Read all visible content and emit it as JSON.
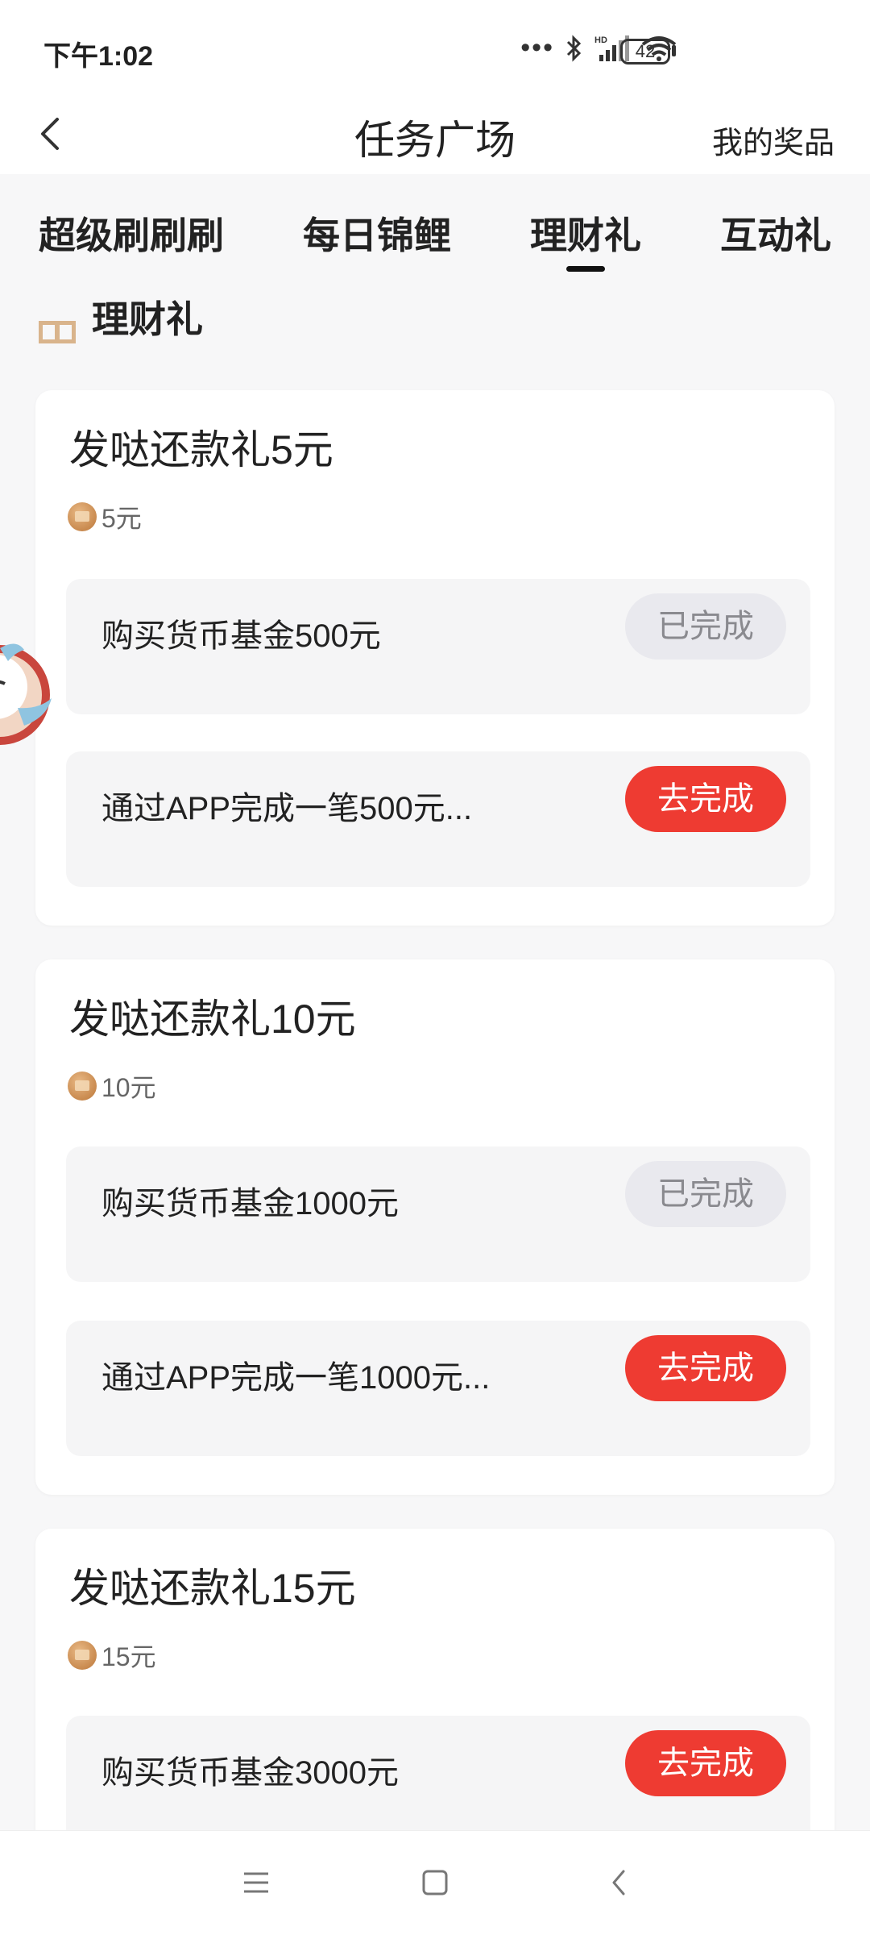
{
  "status_bar": {
    "time": "下午1:02",
    "battery": "42",
    "icons": [
      "more-dots-icon",
      "bluetooth-icon",
      "hd-signal-icon",
      "wifi-icon",
      "battery-icon"
    ]
  },
  "nav": {
    "title": "任务广场",
    "right_link": "我的奖品"
  },
  "tabs": [
    {
      "label": "超级刷刷刷",
      "active": false
    },
    {
      "label": "每日锦鲤",
      "active": false
    },
    {
      "label": "理财礼",
      "active": true
    },
    {
      "label": "互动礼",
      "active": false
    }
  ],
  "section": {
    "title": "理财礼"
  },
  "cards": [
    {
      "title": "发哒还款礼5元",
      "reward": "5元",
      "tasks": [
        {
          "text": "购买货币基金500元",
          "button": "已完成",
          "status": "done"
        },
        {
          "text": "通过APP完成一笔500元...",
          "button": "去完成",
          "status": "todo"
        }
      ]
    },
    {
      "title": "发哒还款礼10元",
      "reward": "10元",
      "tasks": [
        {
          "text": "购买货币基金1000元",
          "button": "已完成",
          "status": "done"
        },
        {
          "text": "通过APP完成一笔1000元...",
          "button": "去完成",
          "status": "todo"
        }
      ]
    },
    {
      "title": "发哒还款礼15元",
      "reward": "15元",
      "tasks": [
        {
          "text": "购买货币基金3000元",
          "button": "去完成",
          "status": "todo"
        }
      ]
    }
  ],
  "colors": {
    "accent_red": "#ee3b32",
    "done_gray": "#e9e9ee",
    "section_icon": "#d9b48c",
    "coin": "#c98a4f"
  }
}
